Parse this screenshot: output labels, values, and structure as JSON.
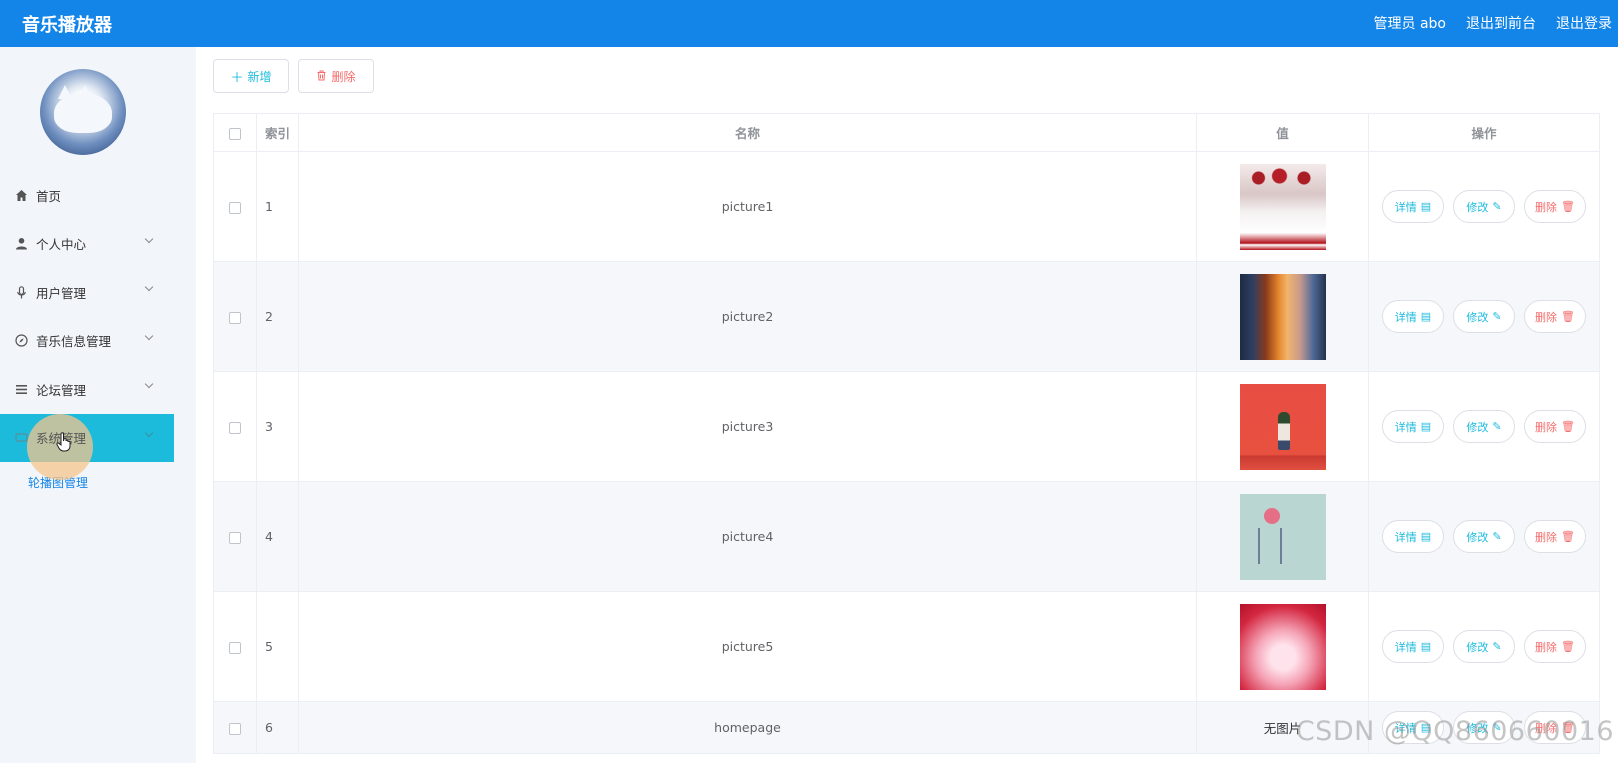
{
  "header": {
    "app_title": "音乐播放器",
    "user_label": "管理员 abo",
    "frontend_link": "退出到前台",
    "logout_link": "退出登录"
  },
  "sidebar": {
    "items": [
      {
        "label": "首页",
        "icon": "home-icon",
        "has_children": false
      },
      {
        "label": "个人中心",
        "icon": "user-icon",
        "has_children": true
      },
      {
        "label": "用户管理",
        "icon": "microphone-icon",
        "has_children": true
      },
      {
        "label": "音乐信息管理",
        "icon": "compass-icon",
        "has_children": true
      },
      {
        "label": "论坛管理",
        "icon": "menu-lines-icon",
        "has_children": true
      },
      {
        "label": "系统管理",
        "icon": "settings-icon",
        "has_children": true,
        "active": true
      }
    ],
    "submenu": {
      "label": "轮播图管理"
    }
  },
  "toolbar": {
    "add_label": "新增",
    "delete_label": "删除"
  },
  "table": {
    "columns": [
      "索引",
      "名称",
      "值",
      "操作"
    ],
    "rows": [
      {
        "index": "1",
        "name": "picture1",
        "value_type": "image"
      },
      {
        "index": "2",
        "name": "picture2",
        "value_type": "image"
      },
      {
        "index": "3",
        "name": "picture3",
        "value_type": "image"
      },
      {
        "index": "4",
        "name": "picture4",
        "value_type": "image"
      },
      {
        "index": "5",
        "name": "picture5",
        "value_type": "image"
      },
      {
        "index": "6",
        "name": "homepage",
        "value_type": "text",
        "value_text": "无图片"
      }
    ],
    "actions": {
      "detail": "详情",
      "edit": "修改",
      "delete": "删除"
    }
  },
  "watermark": "CSDN @QQ860660016",
  "colors": {
    "header": "#1485e8",
    "active_menu": "#1cbbdc",
    "primary_text_button": "#1cbbdc",
    "danger": "#f56c6c"
  }
}
